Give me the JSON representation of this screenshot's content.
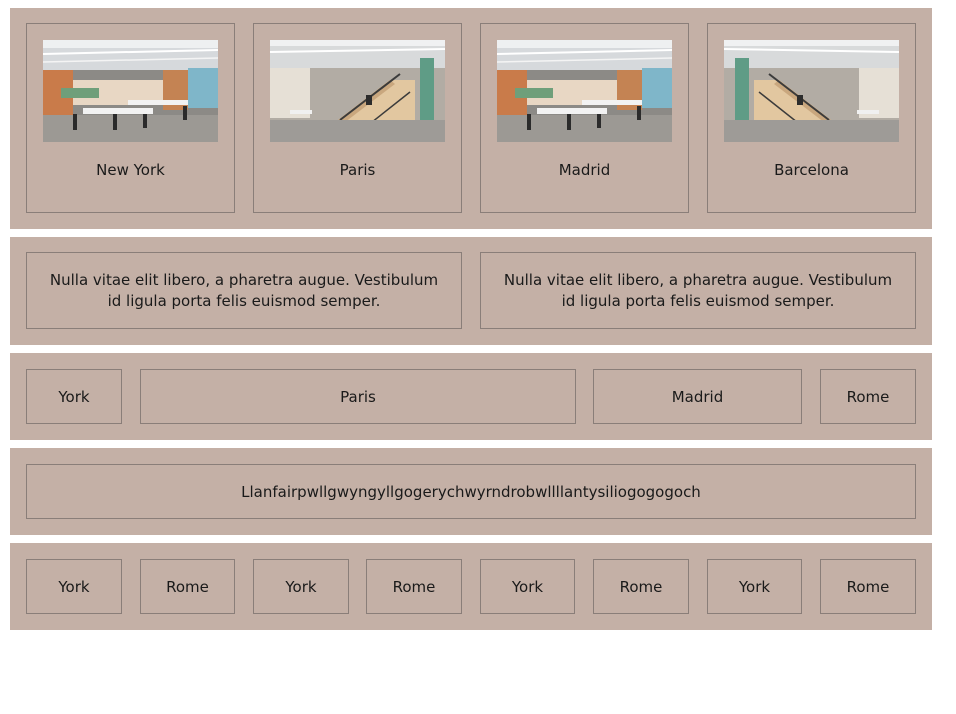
{
  "row1": {
    "cards": [
      {
        "label": "New York",
        "photo": "office-dining-photo"
      },
      {
        "label": "Paris",
        "photo": "office-stairs-photo"
      },
      {
        "label": "Madrid",
        "photo": "office-dining-photo"
      },
      {
        "label": "Barcelona",
        "photo": "office-stairs-photo"
      }
    ]
  },
  "row2": {
    "texts": [
      "Nulla vitae elit libero, a pharetra augue. Vestibulum id ligula porta felis euismod semper.",
      "Nulla vitae elit libero, a pharetra augue. Vestibulum id ligula porta felis euismod semper."
    ]
  },
  "row3": {
    "items": [
      "York",
      "Paris",
      "Madrid",
      "Rome"
    ]
  },
  "row4": {
    "text": "Llanfairpwllgwyngyllgogerychwyrndrobwllllantysiliogogogoch"
  },
  "row5": {
    "items": [
      "York",
      "Rome",
      "York",
      "Rome",
      "York",
      "Rome",
      "York",
      "Rome"
    ]
  },
  "colors": {
    "row_background": "#c4b0a6",
    "cell_border": "#8a7e79",
    "page_background": "#ffffff"
  }
}
